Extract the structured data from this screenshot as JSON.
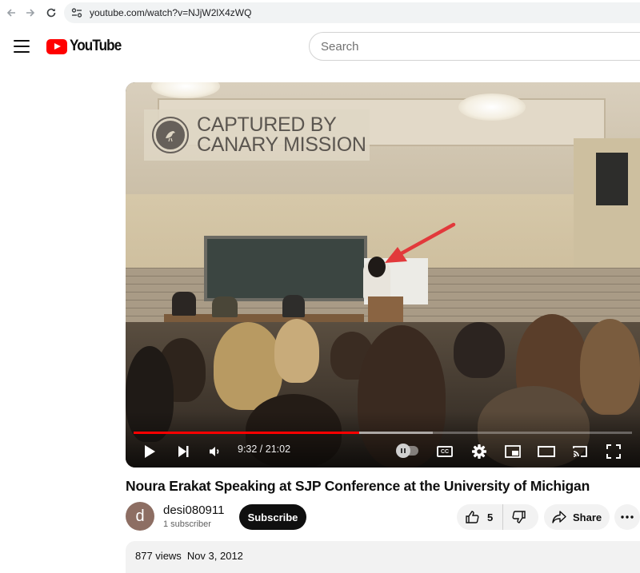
{
  "browser": {
    "url": "youtube.com/watch?v=NJjW2lX4zWQ",
    "icons": {
      "back": "arrow-left-icon",
      "forward": "arrow-right-icon",
      "reload": "reload-icon",
      "site_info": "site-info-icon"
    }
  },
  "header": {
    "logo_text": "YouTube",
    "search_placeholder": "Search",
    "brand_color": "#ff0000"
  },
  "player": {
    "watermark_line1": "CAPTURED BY",
    "watermark_line2": "CANARY MISSION",
    "current_time": "9:32",
    "duration": "21:02",
    "time_display": "9:32 / 21:02",
    "played_fraction": 0.453,
    "buffered_fraction": 0.6,
    "cc_label": "CC",
    "progress_color": "#ff0000"
  },
  "video": {
    "title": "Noura Erakat Speaking at SJP Conference at the University of Michigan",
    "channel": {
      "avatar_letter": "d",
      "name": "desi080911",
      "subscribers": "1 subscriber"
    },
    "subscribe_label": "Subscribe",
    "like_count": "5",
    "share_label": "Share",
    "views": "877 views",
    "date": "Nov 3, 2012"
  }
}
